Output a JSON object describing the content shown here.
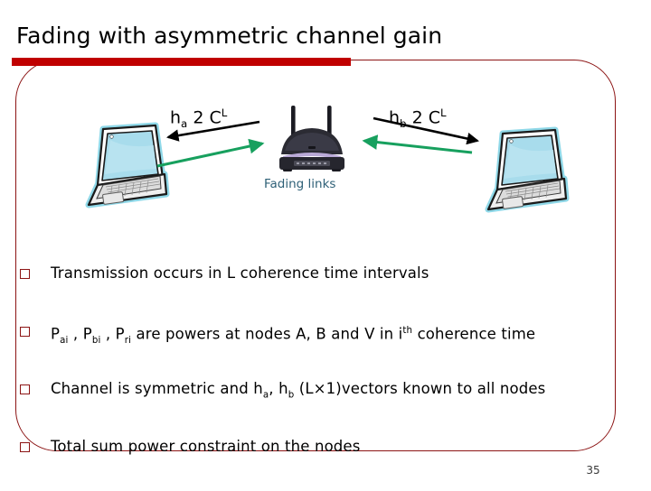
{
  "slide": {
    "title": "Fading with asymmetric channel gain",
    "page_number": "35",
    "accent_color": "#C00000",
    "frame_border_color": "#8C1414",
    "bullet_marker_color": "#8C1414",
    "background": "#FFFFFF"
  },
  "diagram": {
    "fading_links_label": "Fading links",
    "fading_links_color": "#2E6077",
    "left_channel": {
      "symbol": "h",
      "subscript": "a",
      "relation": "2",
      "space": "C",
      "exponent": "L"
    },
    "right_channel": {
      "symbol": "h",
      "subscript": "b",
      "relation": "2",
      "space": "C",
      "exponent": "L"
    },
    "arrow_black_color": "#000000",
    "arrow_green_color": "#17A05E",
    "nodes": [
      {
        "name": "left-laptop",
        "kind": "laptop"
      },
      {
        "name": "center-router",
        "kind": "router"
      },
      {
        "name": "right-laptop",
        "kind": "laptop"
      }
    ]
  },
  "bullets": [
    {
      "marker": "square",
      "parts": [
        {
          "t": "Transmission occurs in L coherence time intervals"
        }
      ]
    },
    {
      "marker": "square",
      "parts": [
        {
          "t": "P"
        },
        {
          "sub": "ai"
        },
        {
          "t": " , P"
        },
        {
          "sub": "bi"
        },
        {
          "t": " , P"
        },
        {
          "sub": "ri"
        },
        {
          "t": " are powers at nodes A, B and V in i"
        },
        {
          "sup": "th"
        },
        {
          "t": " coherence time"
        }
      ]
    },
    {
      "marker": "square",
      "parts": [
        {
          "t": "Channel is symmetric and h"
        },
        {
          "sub": "a"
        },
        {
          "t": ", h"
        },
        {
          "sub": "b"
        },
        {
          "t": " (L×1)vectors known to all nodes"
        }
      ]
    },
    {
      "marker": "square",
      "parts": [
        {
          "t": "Total sum power constraint on the nodes"
        }
      ]
    }
  ]
}
